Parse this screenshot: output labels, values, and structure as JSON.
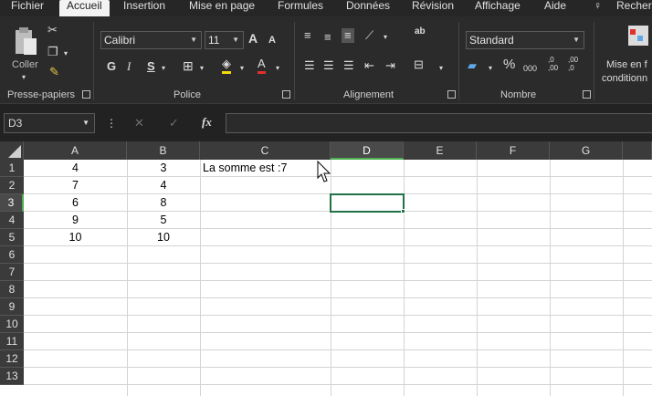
{
  "ribbon_tabs": [
    "Fichier",
    "Accueil",
    "Insertion",
    "Mise en page",
    "Formules",
    "Données",
    "Révision",
    "Affichage",
    "Aide",
    "Recherc"
  ],
  "active_tab": "Accueil",
  "ribbon": {
    "clipboard": {
      "paste_label": "Coller",
      "group_label": "Presse-papiers"
    },
    "font": {
      "name": "Calibri",
      "size": "11",
      "grow": "A",
      "shrink": "A",
      "bold": "G",
      "italic": "I",
      "underline": "S",
      "fill_letter": "A",
      "group_label": "Police"
    },
    "alignment": {
      "wrap_icon": "ab",
      "group_label": "Alignement"
    },
    "number": {
      "format": "Standard",
      "percent": "%",
      "thousands": "000",
      "inc_decimal": ",0 ,00",
      "dec_decimal": ",00 ,0",
      "group_label": "Nombre"
    },
    "styles": {
      "cond_format_label_1": "Mise en f",
      "cond_format_label_2": "conditionn"
    }
  },
  "formula_bar": {
    "name_box": "D3",
    "cancel": "✕",
    "enter": "✓",
    "fx": "fx",
    "content": ""
  },
  "columns": [
    "A",
    "B",
    "C",
    "D",
    "E",
    "F",
    "G"
  ],
  "selected_column": "D",
  "rows": [
    "1",
    "2",
    "3",
    "4",
    "5",
    "6",
    "7",
    "8",
    "9",
    "10",
    "11",
    "12",
    "13"
  ],
  "selected_row": "3",
  "cells": {
    "A1": "4",
    "B1": "3",
    "C1": "La somme est :7",
    "A2": "7",
    "B2": "4",
    "A3": "6",
    "B3": "8",
    "A4": "9",
    "B4": "5",
    "A5": "10",
    "B5": "10"
  },
  "selected_cell": "D3",
  "colors": {
    "accent": "#217346",
    "select_indicator": "#4caf50"
  }
}
